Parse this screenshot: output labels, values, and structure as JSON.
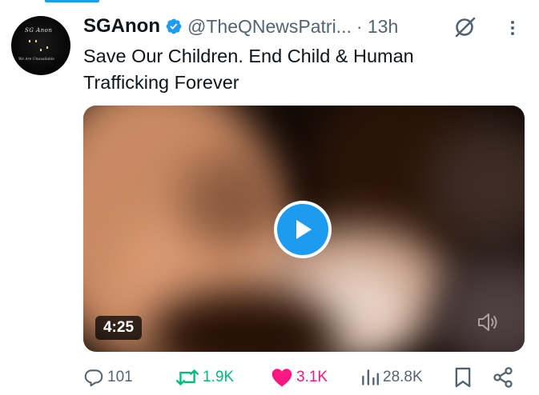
{
  "tweet": {
    "display_name": "SGAnon",
    "handle": "@TheQNewsPatri...",
    "timestamp": "· 13h",
    "text": "Save Our Children. End Child & Human Trafficking Forever",
    "verified": true,
    "avatar": {
      "title": "SG Anon",
      "subtitle": "We Are Unavailable"
    }
  },
  "media": {
    "type": "video",
    "duration": "4:25",
    "icons": {
      "play": "play-icon",
      "volume": "volume-muted-icon"
    }
  },
  "actions": {
    "replies": "101",
    "reposts": "1.9K",
    "likes": "3.1K",
    "views": "28.8K",
    "liked": true
  },
  "colors": {
    "accent": "#1d9bf0",
    "text": "#0f1419",
    "secondary": "#536471",
    "repost": "#00ba7c",
    "like": "#f91880"
  }
}
